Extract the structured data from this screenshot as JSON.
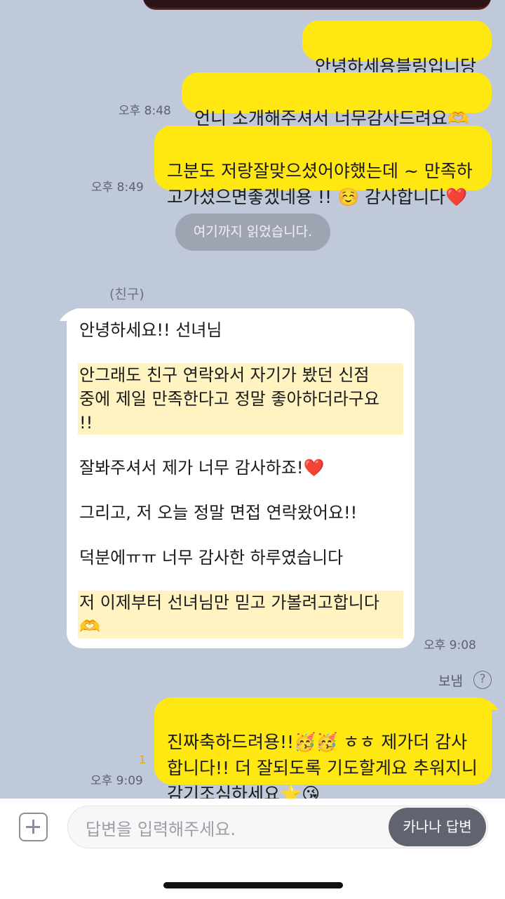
{
  "messages": {
    "sent1": {
      "text": "안녕하세용블링입니당"
    },
    "sent2": {
      "text": "언니 소개해주셔서 너무감사드려요🫶",
      "time": "오후 8:48"
    },
    "sent3": {
      "text": "그분도 저랑잘맞으셨어야했는데 ~ 만족하\n고가셨으면좋겠네용 !! ☺️ 감사합니다❤️",
      "time": "오후 8:49"
    },
    "read_marker": "여기까지 읽었습니다.",
    "received": {
      "sender": "(친구)",
      "paragraphs": [
        "안녕하세요!! 선녀님",
        "안그래도 친구 연락와서 자기가 봤던 신점\n중에 제일 만족한다고 정말 좋아하더라구요\n!!",
        "잘봐주셔서 제가 너무 감사하죠!❤️",
        "그리고, 저 오늘 정말 면접 연락왔어요!!",
        "덕분에ㅠㅠ 너무 감사한 하루였습니다",
        "저 이제부터 선녀님만 믿고 가볼려고합니다\n🫶"
      ],
      "time": "오후 9:08"
    },
    "sent_label": "보냄",
    "reply": {
      "text": "진짜축하드려용!!🥳🥳 ㅎㅎ 제가더 감사\n합니다!! 더 잘되도록 기도할게요 추워지니\n감기조심하세요⭐😘",
      "time": "오후 9:09",
      "unread": "1"
    }
  },
  "input": {
    "placeholder": "답변을 입력해주세요.",
    "kanana_button": "카나나 답변"
  },
  "icons": {
    "help": "question-circle-icon",
    "add": "plus-icon"
  },
  "colors": {
    "chat_bg": "#bfc9d9",
    "my_bubble": "#ffe812",
    "highlight": "#fff3c2"
  }
}
